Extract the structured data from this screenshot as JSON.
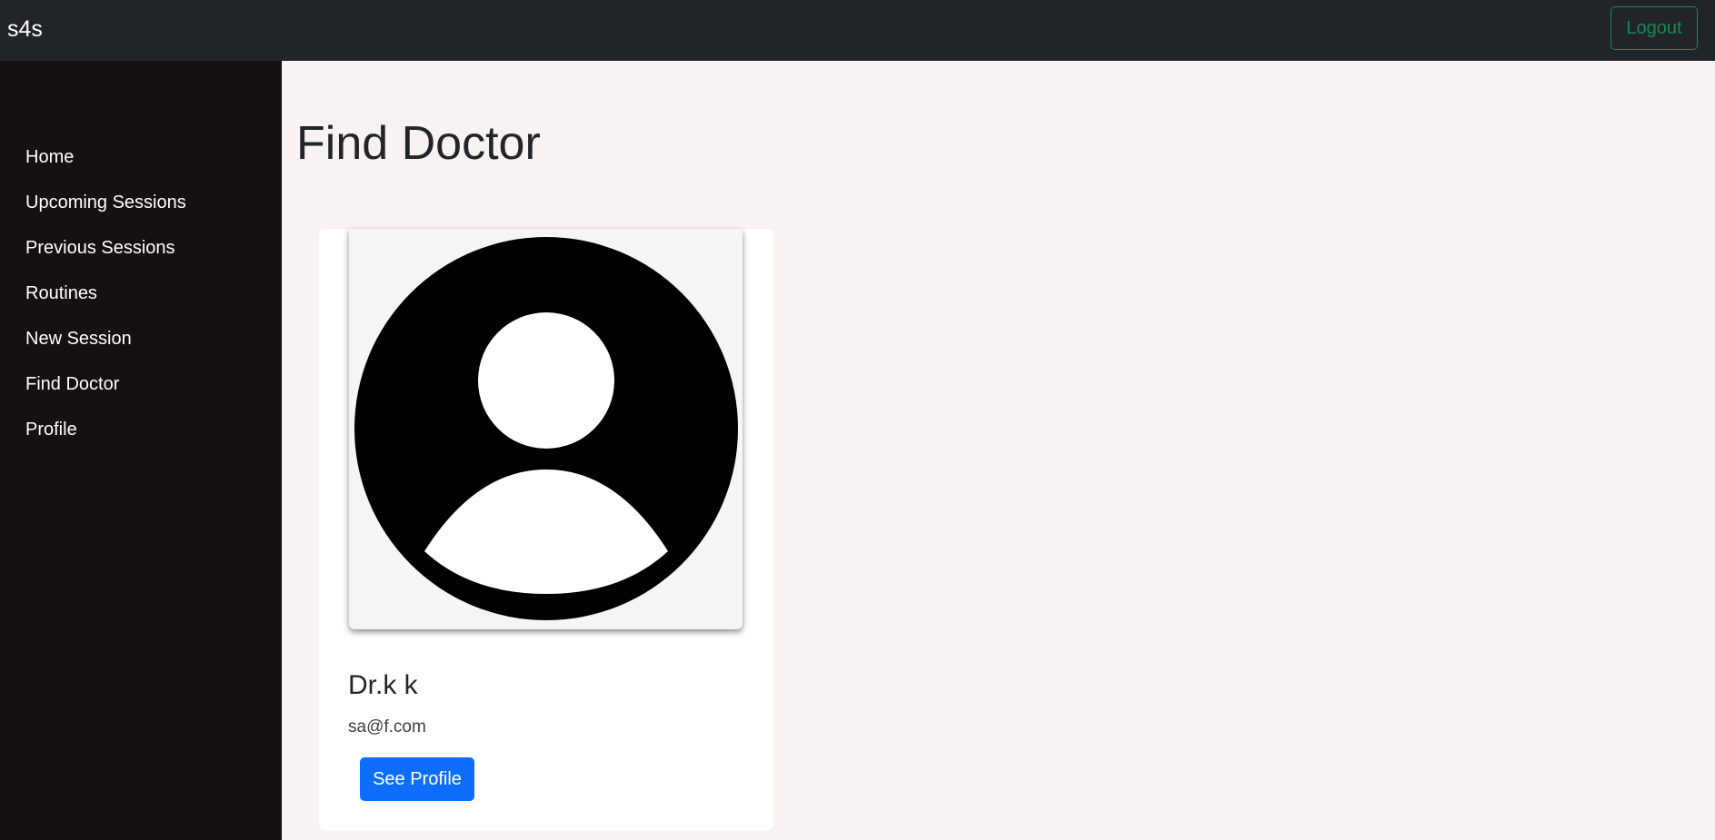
{
  "app": {
    "brand": "s4s"
  },
  "header": {
    "logout_label": "Logout"
  },
  "sidebar": {
    "items": [
      {
        "label": "Home"
      },
      {
        "label": "Upcoming Sessions"
      },
      {
        "label": "Previous Sessions"
      },
      {
        "label": "Routines"
      },
      {
        "label": "New Session"
      },
      {
        "label": "Find Doctor"
      },
      {
        "label": "Profile"
      }
    ]
  },
  "main": {
    "title": "Find Doctor",
    "doctors": [
      {
        "name": "Dr.k k",
        "email": "sa@f.com",
        "button_label": "See Profile",
        "avatar_icon": "user-avatar-icon"
      }
    ]
  },
  "colors": {
    "topbar": "#212529",
    "sidebar": "#161010",
    "page_background": "#f8f2f2",
    "logout_accent": "#198754",
    "primary_button": "#0d6efd"
  }
}
